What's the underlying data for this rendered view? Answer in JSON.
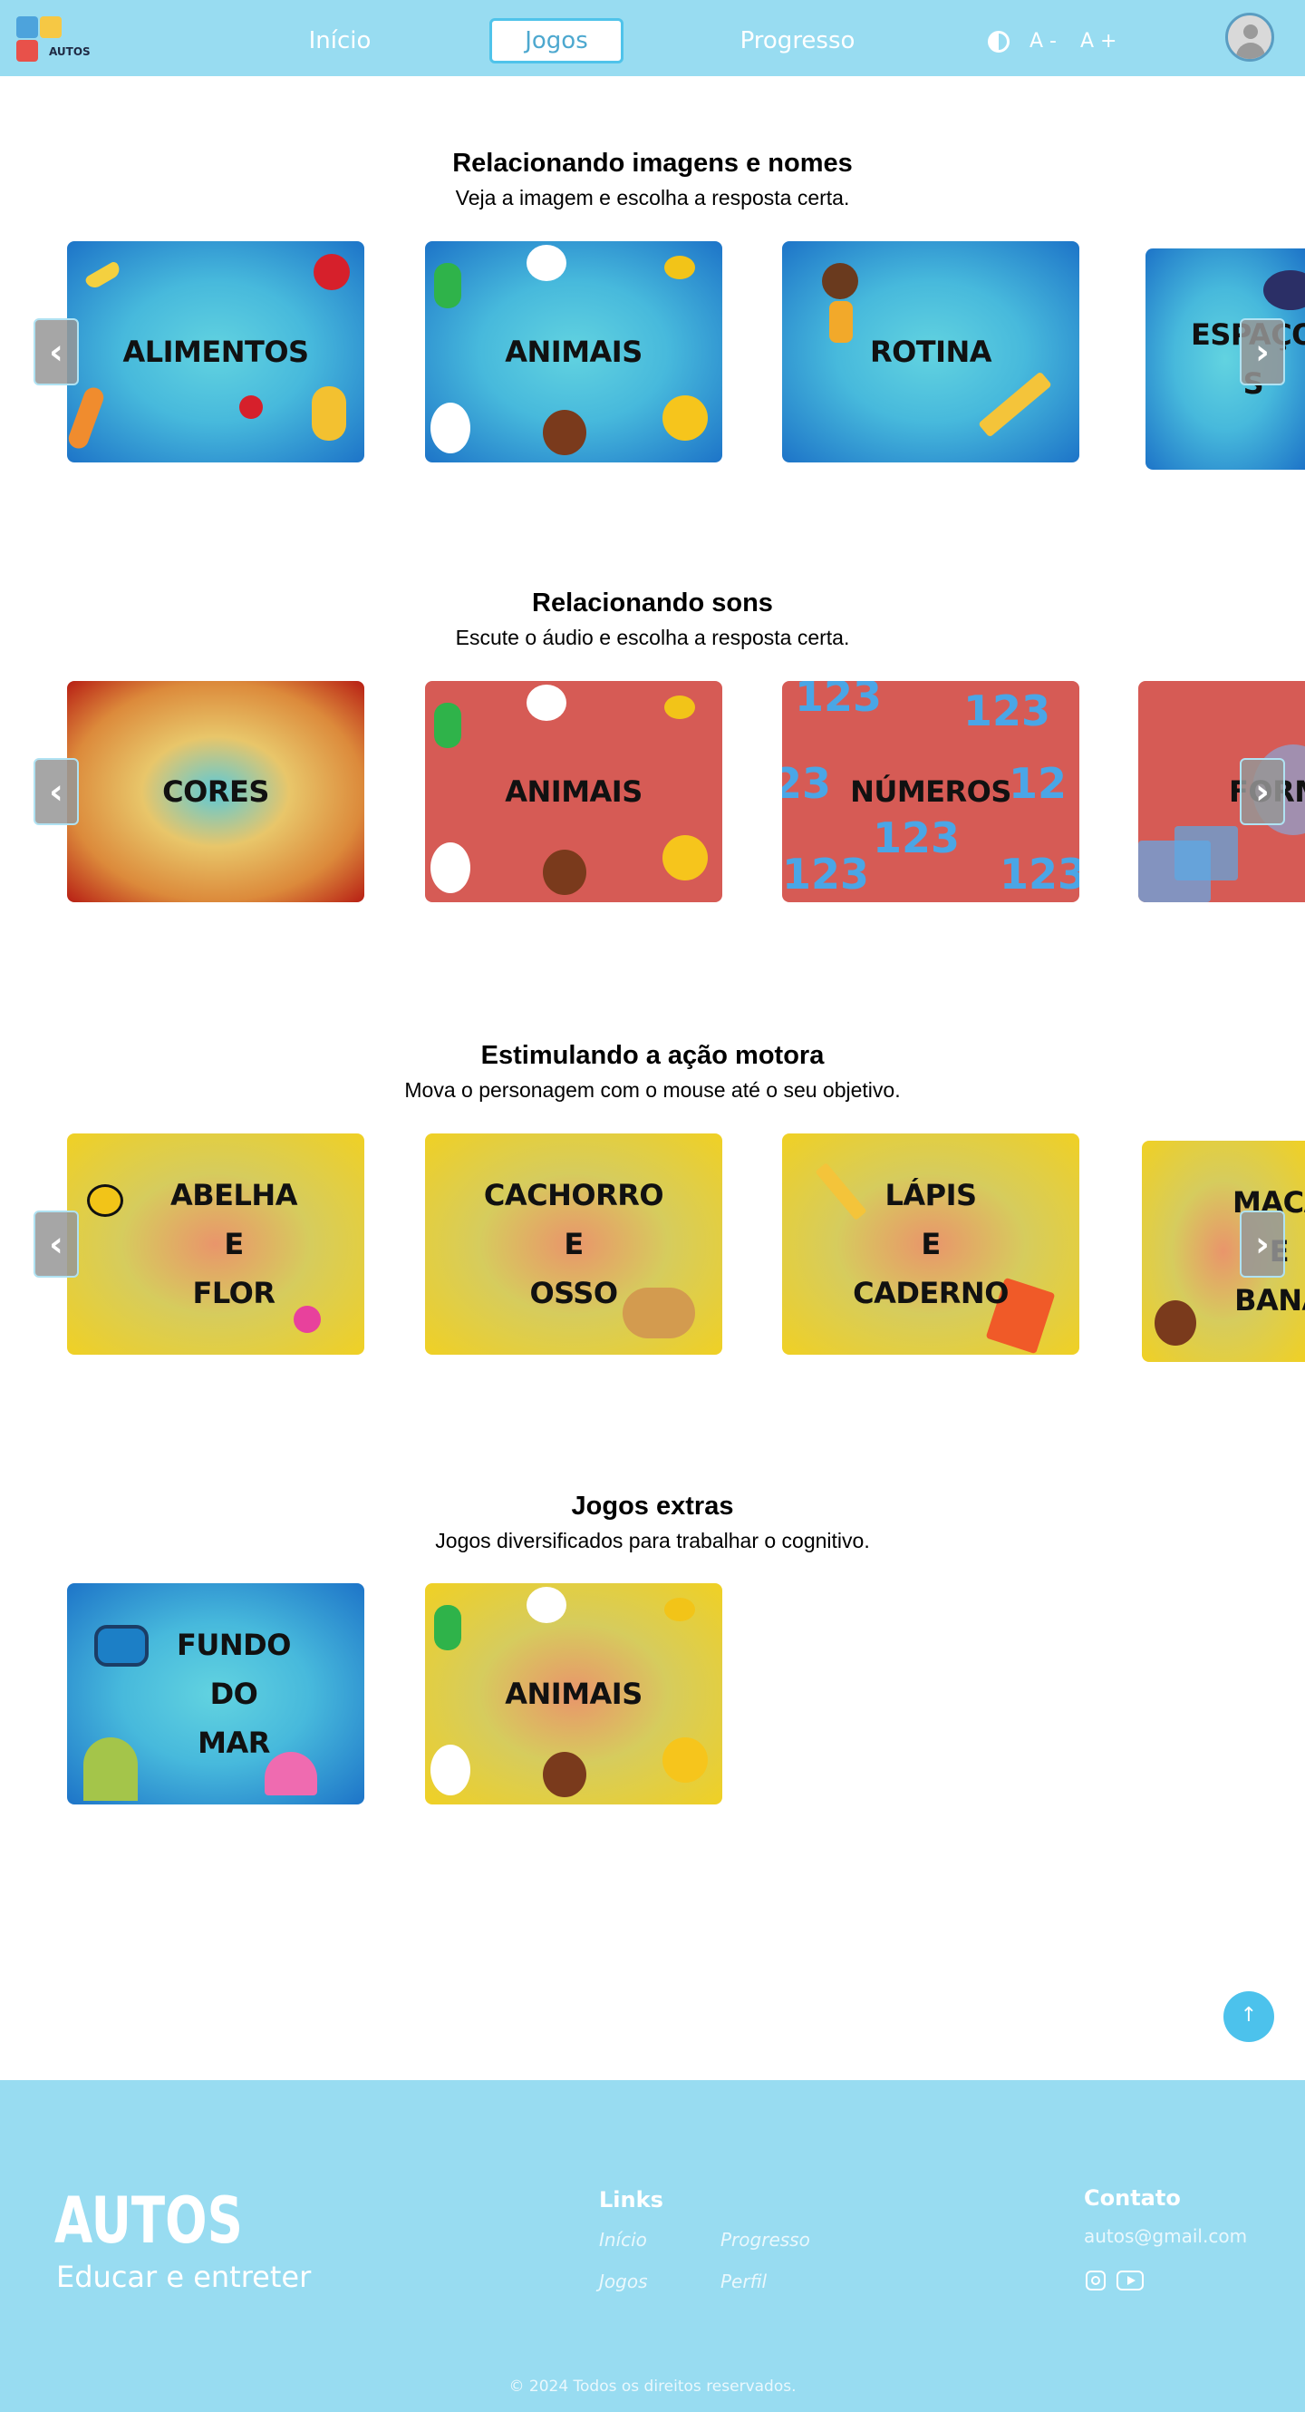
{
  "header": {
    "logo_text": "AUTOS",
    "nav": [
      "Início",
      "Jogos",
      "Progresso"
    ],
    "active_nav": "Jogos",
    "font_decrease": "A -",
    "font_increase": "A +"
  },
  "sections": [
    {
      "title": "Relacionando imagens e nomes",
      "subtitle": "Veja a imagem e escolha a resposta certa.",
      "cards": [
        "ALIMENTOS",
        "ANIMAIS",
        "ROTINA",
        "ESPAÇO S"
      ]
    },
    {
      "title": "Relacionando sons",
      "subtitle": "Escute o áudio e escolha a resposta certa.",
      "cards": [
        "CORES",
        "ANIMAIS",
        "NÚMEROS",
        "FORM"
      ]
    },
    {
      "title": "Estimulando a ação motora",
      "subtitle": "Mova o personagem com o mouse até o seu objetivo.",
      "cards": [
        "ABELHA\nE\nFLOR",
        "CACHORRO\nE\nOSSO",
        "LÁPIS\nE\nCADERNO",
        "MACA\nE\nBANA"
      ]
    },
    {
      "title": "Jogos extras",
      "subtitle": "Jogos diversificados para trabalhar o cognitivo.",
      "cards": [
        "FUNDO\nDO\nMAR",
        "ANIMAIS"
      ]
    }
  ],
  "icons": {
    "prev": "chevron-left-icon",
    "next": "chevron-right-icon",
    "scroll_top": "arrow-up-icon",
    "contrast": "contrast-icon",
    "avatar": "user-icon"
  },
  "colors": {
    "header_bg": "#98dcf1",
    "footer_bg": "#98dcf1",
    "accent": "#4cc2ec"
  },
  "footer": {
    "brand": "AUTOS",
    "tagline": "Educar e entreter",
    "links_title": "Links",
    "links": [
      "Início",
      "Progresso",
      "Jogos",
      "Perfil"
    ],
    "contact_title": "Contato",
    "email": "autos@gmail.com",
    "copyright": "© 2024 Todos os direitos reservados."
  }
}
